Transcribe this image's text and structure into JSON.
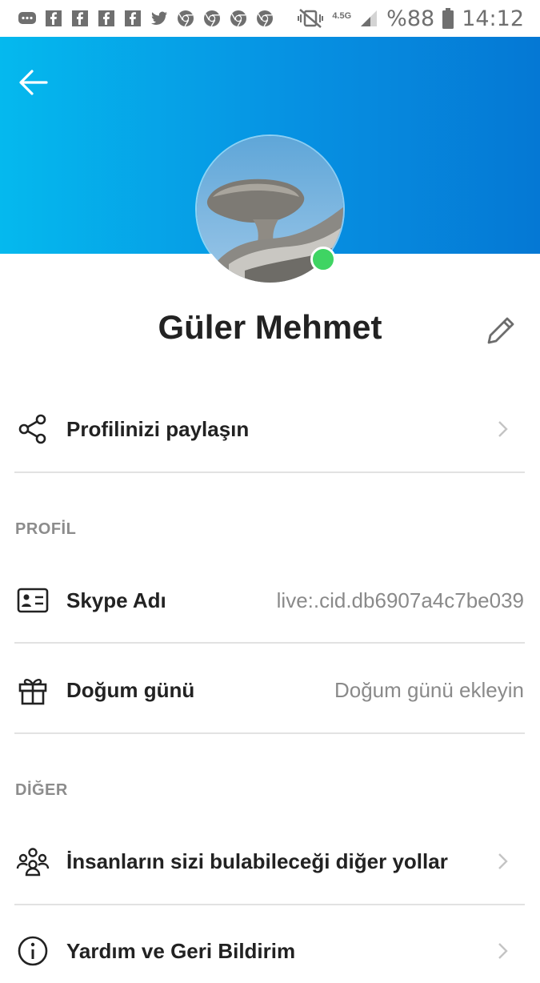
{
  "status_bar": {
    "battery": "%88",
    "time": "14:12",
    "network": "4.5G",
    "notification_icons": [
      "messages-icon",
      "facebook-icon",
      "facebook-icon",
      "facebook-icon",
      "facebook-icon",
      "twitter-icon",
      "chrome-icon",
      "chrome-icon",
      "chrome-icon",
      "chrome-icon"
    ]
  },
  "header": {
    "gradient_start": "#05b9ee",
    "gradient_end": "#0578d4"
  },
  "profile": {
    "name": "Güler Mehmet",
    "presence_color": "#3fd463"
  },
  "share_row": {
    "label": "Profilinizi paylaşın"
  },
  "sections": {
    "profile_title": "PROFİL",
    "other_title": "DİĞER"
  },
  "profile_rows": [
    {
      "label": "Skype Adı",
      "value": "live:.cid.db6907a4c7be039"
    },
    {
      "label": "Doğum günü",
      "value": "Doğum günü ekleyin"
    }
  ],
  "other_rows": [
    {
      "label": "İnsanların sizi bulabileceği diğer yollar"
    },
    {
      "label": "Yardım ve Geri Bildirim"
    }
  ]
}
